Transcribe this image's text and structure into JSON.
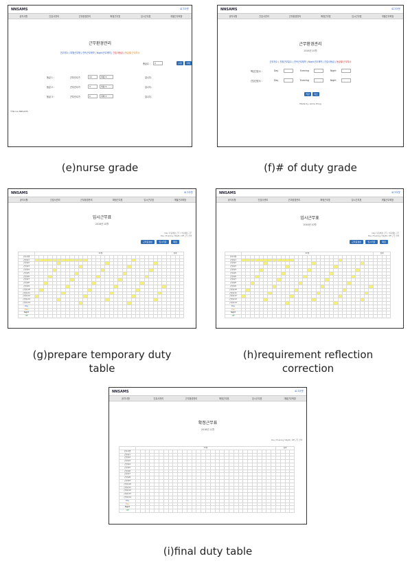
{
  "common": {
    "logo": "NNSAMS",
    "logout": "로그아웃",
    "nav": [
      "공지사항",
      "간호사관리",
      "근무환경관리",
      "확정근무표",
      "임시근무표",
      "개별근무희망"
    ]
  },
  "panel_e": {
    "caption": "(e)nurse grade",
    "title": "근무환경관리",
    "links": [
      {
        "text": "근무자수",
        "color": "a"
      },
      {
        "text": " | ",
        "color": "a"
      },
      {
        "text": "피형근무형",
        "color": "a"
      },
      {
        "text": " | ",
        "color": "a"
      },
      {
        "text": "연속근무제약",
        "color": "a"
      },
      {
        "text": " | ",
        "color": "a"
      },
      {
        "text": "Night근무제약",
        "color": "a"
      },
      {
        "text": " | ",
        "color": "a"
      },
      {
        "text": "간호사등급",
        "color": "r"
      },
      {
        "text": " | ",
        "color": "a"
      },
      {
        "text": "등급별 근무자수",
        "color": "o"
      }
    ],
    "grade_count_label": "총급수 :",
    "grade_count_value": "3",
    "btn_edit": "수정",
    "btn_delete": "삭제",
    "rows": [
      {
        "label": "등급 1 :",
        "field": "근무년수가",
        "value": "10",
        "op": "이상",
        "suffix": "입니다."
      },
      {
        "label": "등급 2 :",
        "field": "근무년수가",
        "value": "3",
        "op": "이상",
        "suffix": "입니다."
      },
      {
        "label": "등급 3 :",
        "field": "근무년수가",
        "value": "0",
        "op": "이하",
        "suffix": "입니다."
      }
    ],
    "footer": "©Nurse NNSAMS"
  },
  "panel_f": {
    "caption": "(f)# of duty grade",
    "title": "근무환경관리",
    "date": "2016년 10월",
    "links": [
      {
        "text": "근무자수",
        "color": "a"
      },
      {
        "text": " | ",
        "color": "a"
      },
      {
        "text": "지정근무일수",
        "color": "a"
      },
      {
        "text": " | ",
        "color": "a"
      },
      {
        "text": "연속근무제약",
        "color": "a"
      },
      {
        "text": " | ",
        "color": "a"
      },
      {
        "text": "Night근무제약",
        "color": "a"
      },
      {
        "text": " | ",
        "color": "a"
      },
      {
        "text": "간호사등급",
        "color": "a"
      },
      {
        "text": " | ",
        "color": "a"
      },
      {
        "text": "등급별 근무자수",
        "color": "r"
      }
    ],
    "rows": [
      {
        "label": "책임간호사 :",
        "day": "Day",
        "evening": "Evening",
        "night": "Night"
      },
      {
        "label": "선임간호사 :",
        "day": "Day",
        "evening": "Evening",
        "night": "Night"
      }
    ],
    "btn_save": "저장",
    "btn_cancel": "취소",
    "footer": "Made by: some thing"
  },
  "panel_g": {
    "caption_line1": "(g)prepare temporary duty",
    "caption_line2": "table",
    "title": "임시근무표",
    "date": "2016년 10월",
    "legend1": "Day: 자동배정 근무 / 수동배정 근무",
    "legend2": "Day / Evening / Night / Off 근무 선택",
    "buttons": [
      "근무표생성",
      "임시저장",
      "확정"
    ],
    "month": "11월",
    "total": "합계",
    "nurse_header": "간호사명",
    "nurses": [
      "간호사1",
      "간호사2",
      "간호사3",
      "간호사4",
      "간호사5",
      "간호사6",
      "간호사7",
      "간호사8",
      "간호사9",
      "간호사10",
      "간호사11",
      "간호사12",
      "간호사13",
      "간호사14"
    ],
    "summary": [
      "Day",
      "Eve",
      "Night",
      "Off"
    ]
  },
  "panel_h": {
    "caption_line1": "(h)requirement reflection",
    "caption_line2": "correction",
    "title": "임시근무표",
    "date": "2016년 10월",
    "legend1": "Day: 자동배정 근무 / 수동배정 근무",
    "legend2": "Day / Evening / Night / Off 근무 선택",
    "buttons": [
      "근무표생성",
      "임시저장",
      "확정"
    ],
    "month": "11월",
    "total": "합계",
    "nurse_header": "간호사명",
    "nurses": [
      "간호사1",
      "간호사2",
      "간호사3",
      "간호사4",
      "간호사5",
      "간호사6",
      "간호사7",
      "간호사8",
      "간호사9",
      "간호사10",
      "간호사11",
      "간호사12",
      "간호사13",
      "간호사14"
    ],
    "summary": [
      "Day",
      "Eve",
      "Night",
      "Off"
    ]
  },
  "panel_i": {
    "caption": "(i)final duty table",
    "title": "확정근무표",
    "date": "2016년 11월",
    "legend": "Day / Evening / Night / Off 근무 선택",
    "month": "11월",
    "total": "합계",
    "nurse_header": "간호사명",
    "nurses": [
      "간호사1",
      "간호사2",
      "간호사3",
      "간호사4",
      "간호사5",
      "간호사6",
      "간호사7",
      "간호사8",
      "간호사9",
      "간호사10",
      "간호사11",
      "간호사12",
      "간호사13",
      "간호사14"
    ],
    "summary": [
      "Day",
      "Eve",
      "Night",
      "Off"
    ]
  }
}
